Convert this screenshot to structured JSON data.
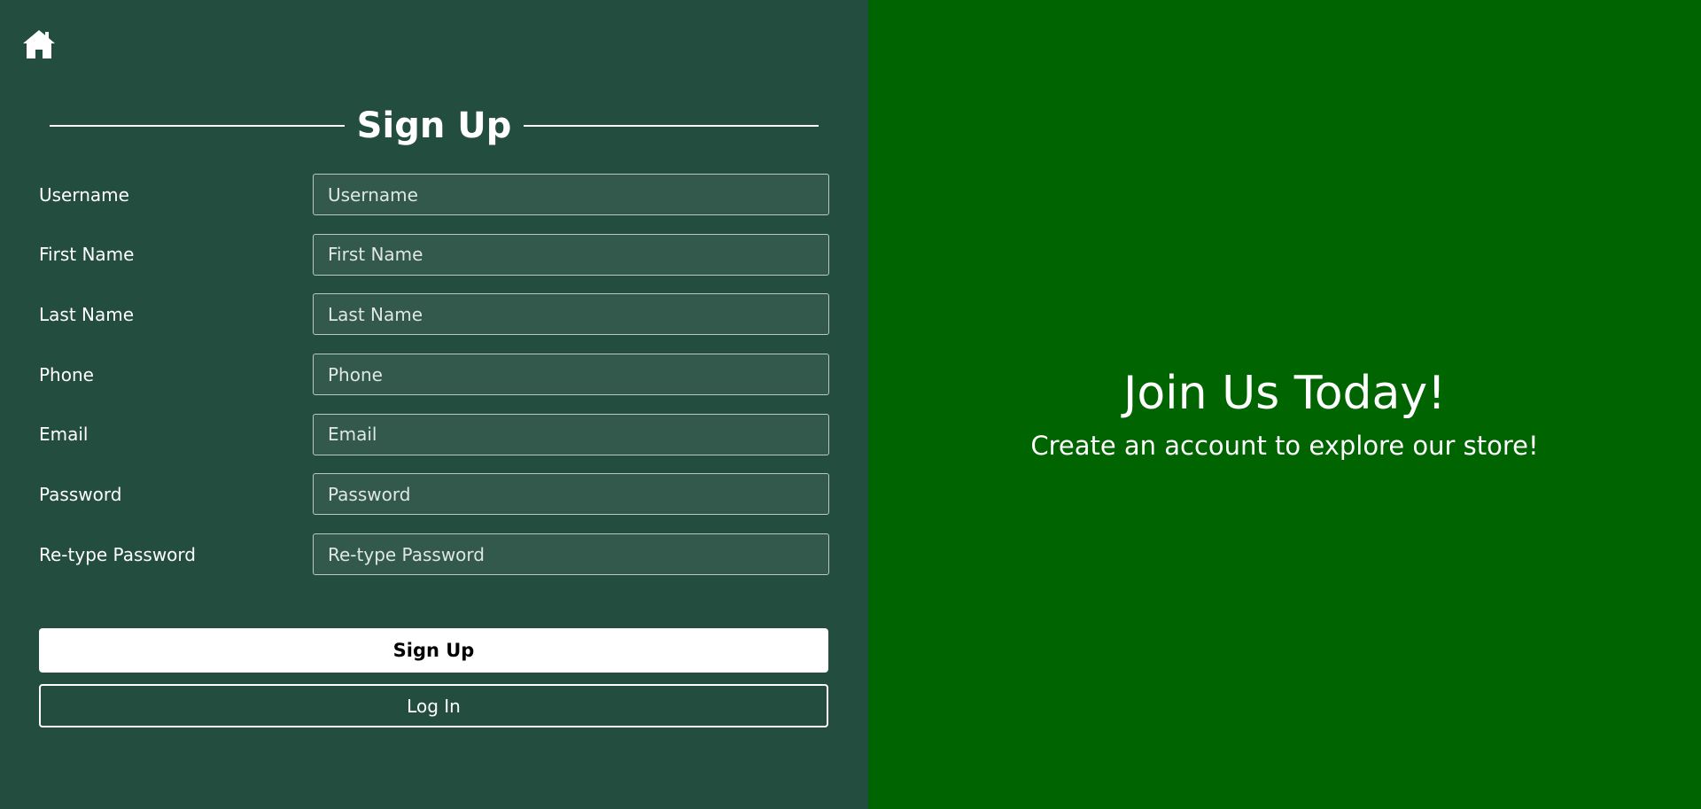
{
  "nav": {
    "home_icon": "home-icon"
  },
  "signup_form": {
    "title": "Sign Up",
    "fields": [
      {
        "label": "Username",
        "placeholder": "Username"
      },
      {
        "label": "First Name",
        "placeholder": "First Name"
      },
      {
        "label": "Last Name",
        "placeholder": "Last Name"
      },
      {
        "label": "Phone",
        "placeholder": "Phone"
      },
      {
        "label": "Email",
        "placeholder": "Email"
      },
      {
        "label": "Password",
        "placeholder": "Password"
      },
      {
        "label": "Re-type Password",
        "placeholder": "Re-type Password"
      }
    ],
    "signup_button": "Sign Up",
    "login_button": "Log In"
  },
  "hero": {
    "title": "Join Us Today!",
    "subtitle": "Create an account to explore our store!"
  },
  "colors": {
    "left_panel": "#234d3e",
    "right_panel": "#006400",
    "input_bg": "#32594b"
  }
}
